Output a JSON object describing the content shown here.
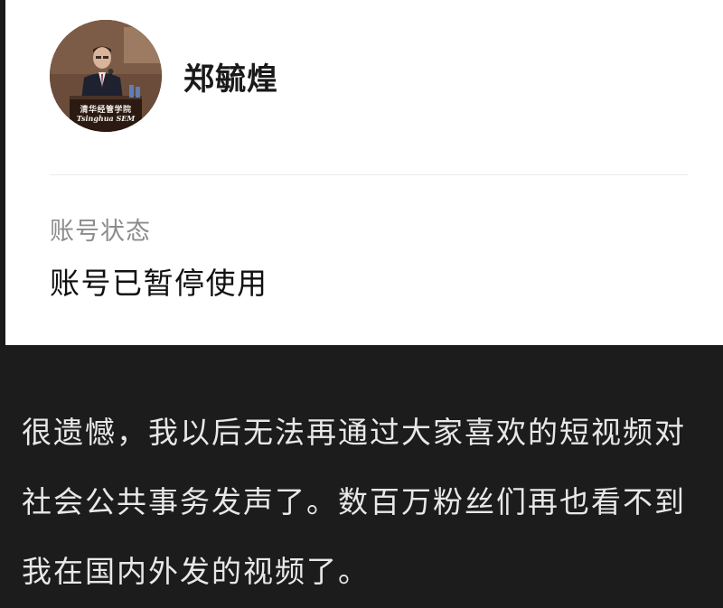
{
  "profile": {
    "name": "郑毓煌",
    "avatar_caption_cn": "清华经管学院",
    "avatar_caption_en": "Tsinghua SEM"
  },
  "account": {
    "status_label": "账号状态",
    "status_value": "账号已暂停使用"
  },
  "message": {
    "lines": [
      "很遗憾，我以后无法再通过大家喜欢的短视频对",
      "社会公共事务发声了。数百万粉丝们再也看不到",
      "我在国内外发的视频了。"
    ]
  },
  "colors": {
    "card_background": "#ffffff",
    "page_background": "#1c1c1c",
    "label_gray": "#8c8c8c",
    "message_text": "#e8e8e8"
  }
}
